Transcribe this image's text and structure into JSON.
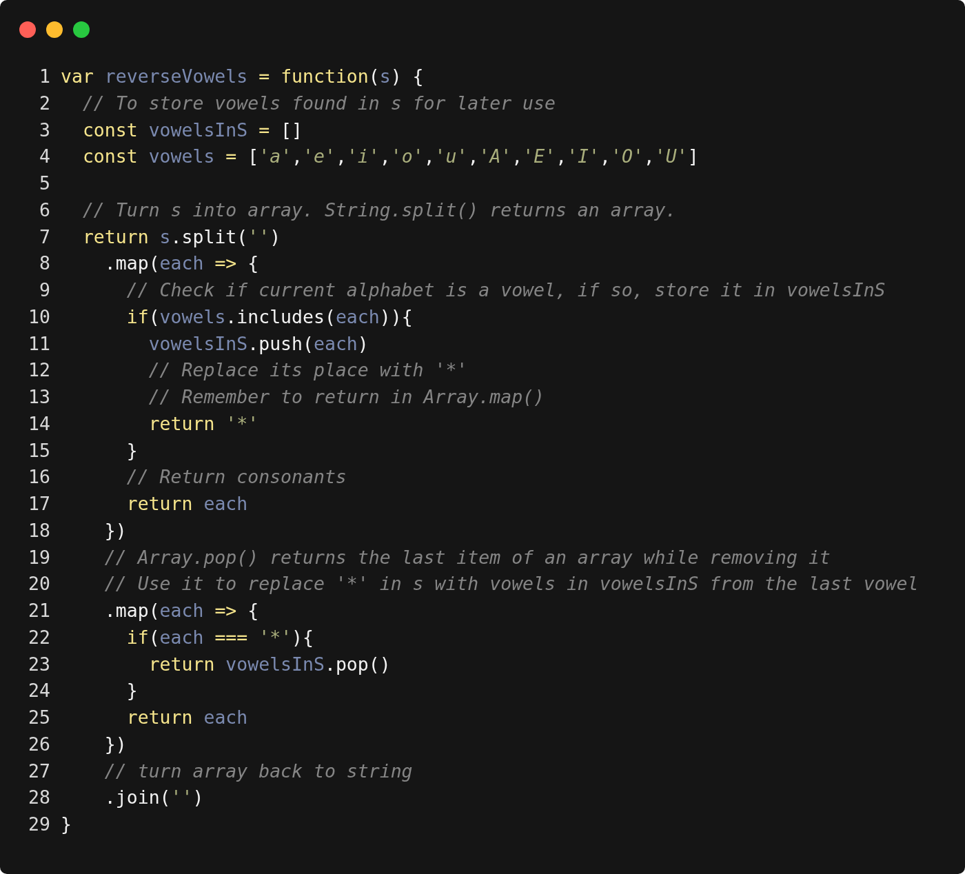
{
  "window_buttons": [
    {
      "color": "#ff5f57"
    },
    {
      "color": "#febc2e"
    },
    {
      "color": "#28c840"
    }
  ],
  "lines": [
    {
      "number": "1",
      "tokens": [
        {
          "kind": "keyword",
          "text": "var "
        },
        {
          "kind": "identifier",
          "text": "reverseVowels "
        },
        {
          "kind": "operator",
          "text": "= "
        },
        {
          "kind": "keyword",
          "text": "function"
        },
        {
          "kind": "plain",
          "text": "("
        },
        {
          "kind": "identifier",
          "text": "s"
        },
        {
          "kind": "plain",
          "text": ") {"
        }
      ]
    },
    {
      "number": "2",
      "tokens": [
        {
          "kind": "comment",
          "text": "  // To store vowels found in s for later use"
        }
      ]
    },
    {
      "number": "3",
      "tokens": [
        {
          "kind": "keyword",
          "text": "  const "
        },
        {
          "kind": "identifier",
          "text": "vowelsInS "
        },
        {
          "kind": "operator",
          "text": "= "
        },
        {
          "kind": "plain",
          "text": "[]"
        }
      ]
    },
    {
      "number": "4",
      "tokens": [
        {
          "kind": "keyword",
          "text": "  const "
        },
        {
          "kind": "identifier",
          "text": "vowels "
        },
        {
          "kind": "operator",
          "text": "= "
        },
        {
          "kind": "plain",
          "text": "["
        },
        {
          "kind": "string",
          "text": "'a'"
        },
        {
          "kind": "plain",
          "text": ","
        },
        {
          "kind": "string",
          "text": "'e'"
        },
        {
          "kind": "plain",
          "text": ","
        },
        {
          "kind": "string",
          "text": "'i'"
        },
        {
          "kind": "plain",
          "text": ","
        },
        {
          "kind": "string",
          "text": "'o'"
        },
        {
          "kind": "plain",
          "text": ","
        },
        {
          "kind": "string",
          "text": "'u'"
        },
        {
          "kind": "plain",
          "text": ","
        },
        {
          "kind": "string",
          "text": "'A'"
        },
        {
          "kind": "plain",
          "text": ","
        },
        {
          "kind": "string",
          "text": "'E'"
        },
        {
          "kind": "plain",
          "text": ","
        },
        {
          "kind": "string",
          "text": "'I'"
        },
        {
          "kind": "plain",
          "text": ","
        },
        {
          "kind": "string",
          "text": "'O'"
        },
        {
          "kind": "plain",
          "text": ","
        },
        {
          "kind": "string",
          "text": "'U'"
        },
        {
          "kind": "plain",
          "text": "]"
        }
      ]
    },
    {
      "number": "5"
    },
    {
      "number": "6",
      "tokens": [
        {
          "kind": "comment",
          "text": "  // Turn s into array. String.split() returns an array."
        }
      ]
    },
    {
      "number": "7",
      "tokens": [
        {
          "kind": "keyword",
          "text": "  return "
        },
        {
          "kind": "identifier",
          "text": "s"
        },
        {
          "kind": "plain",
          "text": ".split("
        },
        {
          "kind": "string",
          "text": "''"
        },
        {
          "kind": "plain",
          "text": ")"
        }
      ]
    },
    {
      "number": "8",
      "tokens": [
        {
          "kind": "plain",
          "text": "    .map("
        },
        {
          "kind": "identifier",
          "text": "each "
        },
        {
          "kind": "operator",
          "text": "=> "
        },
        {
          "kind": "plain",
          "text": "{"
        }
      ]
    },
    {
      "number": "9",
      "tokens": [
        {
          "kind": "comment",
          "text": "      // Check if current alphabet is a vowel, if so, store it in vowelsInS"
        }
      ]
    },
    {
      "number": "10",
      "tokens": [
        {
          "kind": "keyword",
          "text": "      if"
        },
        {
          "kind": "plain",
          "text": "("
        },
        {
          "kind": "identifier",
          "text": "vowels"
        },
        {
          "kind": "plain",
          "text": ".includes("
        },
        {
          "kind": "identifier",
          "text": "each"
        },
        {
          "kind": "plain",
          "text": ")){"
        }
      ]
    },
    {
      "number": "11",
      "tokens": [
        {
          "kind": "identifier",
          "text": "        vowelsInS"
        },
        {
          "kind": "plain",
          "text": ".push("
        },
        {
          "kind": "identifier",
          "text": "each"
        },
        {
          "kind": "plain",
          "text": ")"
        }
      ]
    },
    {
      "number": "12",
      "tokens": [
        {
          "kind": "comment",
          "text": "        // Replace its place with '*'"
        }
      ]
    },
    {
      "number": "13",
      "tokens": [
        {
          "kind": "comment",
          "text": "        // Remember to return in Array.map()"
        }
      ]
    },
    {
      "number": "14",
      "tokens": [
        {
          "kind": "keyword",
          "text": "        return "
        },
        {
          "kind": "string",
          "text": "'*'"
        }
      ]
    },
    {
      "number": "15",
      "tokens": [
        {
          "kind": "plain",
          "text": "      }"
        }
      ]
    },
    {
      "number": "16",
      "tokens": [
        {
          "kind": "comment",
          "text": "      // Return consonants"
        }
      ]
    },
    {
      "number": "17",
      "tokens": [
        {
          "kind": "keyword",
          "text": "      return "
        },
        {
          "kind": "identifier",
          "text": "each"
        }
      ]
    },
    {
      "number": "18",
      "tokens": [
        {
          "kind": "plain",
          "text": "    })"
        }
      ]
    },
    {
      "number": "19",
      "tokens": [
        {
          "kind": "comment",
          "text": "    // Array.pop() returns the last item of an array while removing it"
        }
      ]
    },
    {
      "number": "20",
      "tokens": [
        {
          "kind": "comment",
          "text": "    // Use it to replace '*' in s with vowels in vowelsInS from the last vowel"
        }
      ]
    },
    {
      "number": "21",
      "tokens": [
        {
          "kind": "plain",
          "text": "    .map("
        },
        {
          "kind": "identifier",
          "text": "each "
        },
        {
          "kind": "operator",
          "text": "=> "
        },
        {
          "kind": "plain",
          "text": "{"
        }
      ]
    },
    {
      "number": "22",
      "tokens": [
        {
          "kind": "keyword",
          "text": "      if"
        },
        {
          "kind": "plain",
          "text": "("
        },
        {
          "kind": "identifier",
          "text": "each "
        },
        {
          "kind": "operator",
          "text": "=== "
        },
        {
          "kind": "string",
          "text": "'*'"
        },
        {
          "kind": "plain",
          "text": "){"
        }
      ]
    },
    {
      "number": "23",
      "tokens": [
        {
          "kind": "keyword",
          "text": "        return "
        },
        {
          "kind": "identifier",
          "text": "vowelsInS"
        },
        {
          "kind": "plain",
          "text": ".pop()"
        }
      ]
    },
    {
      "number": "24",
      "tokens": [
        {
          "kind": "plain",
          "text": "      }"
        }
      ]
    },
    {
      "number": "25",
      "tokens": [
        {
          "kind": "keyword",
          "text": "      return "
        },
        {
          "kind": "identifier",
          "text": "each"
        }
      ]
    },
    {
      "number": "26",
      "tokens": [
        {
          "kind": "plain",
          "text": "    })"
        }
      ]
    },
    {
      "number": "27",
      "tokens": [
        {
          "kind": "comment",
          "text": "    // turn array back to string"
        }
      ]
    },
    {
      "number": "28",
      "tokens": [
        {
          "kind": "plain",
          "text": "    .join("
        },
        {
          "kind": "string",
          "text": "''"
        },
        {
          "kind": "plain",
          "text": ")"
        }
      ]
    },
    {
      "number": "29",
      "tokens": [
        {
          "kind": "plain",
          "text": "}"
        }
      ]
    }
  ]
}
